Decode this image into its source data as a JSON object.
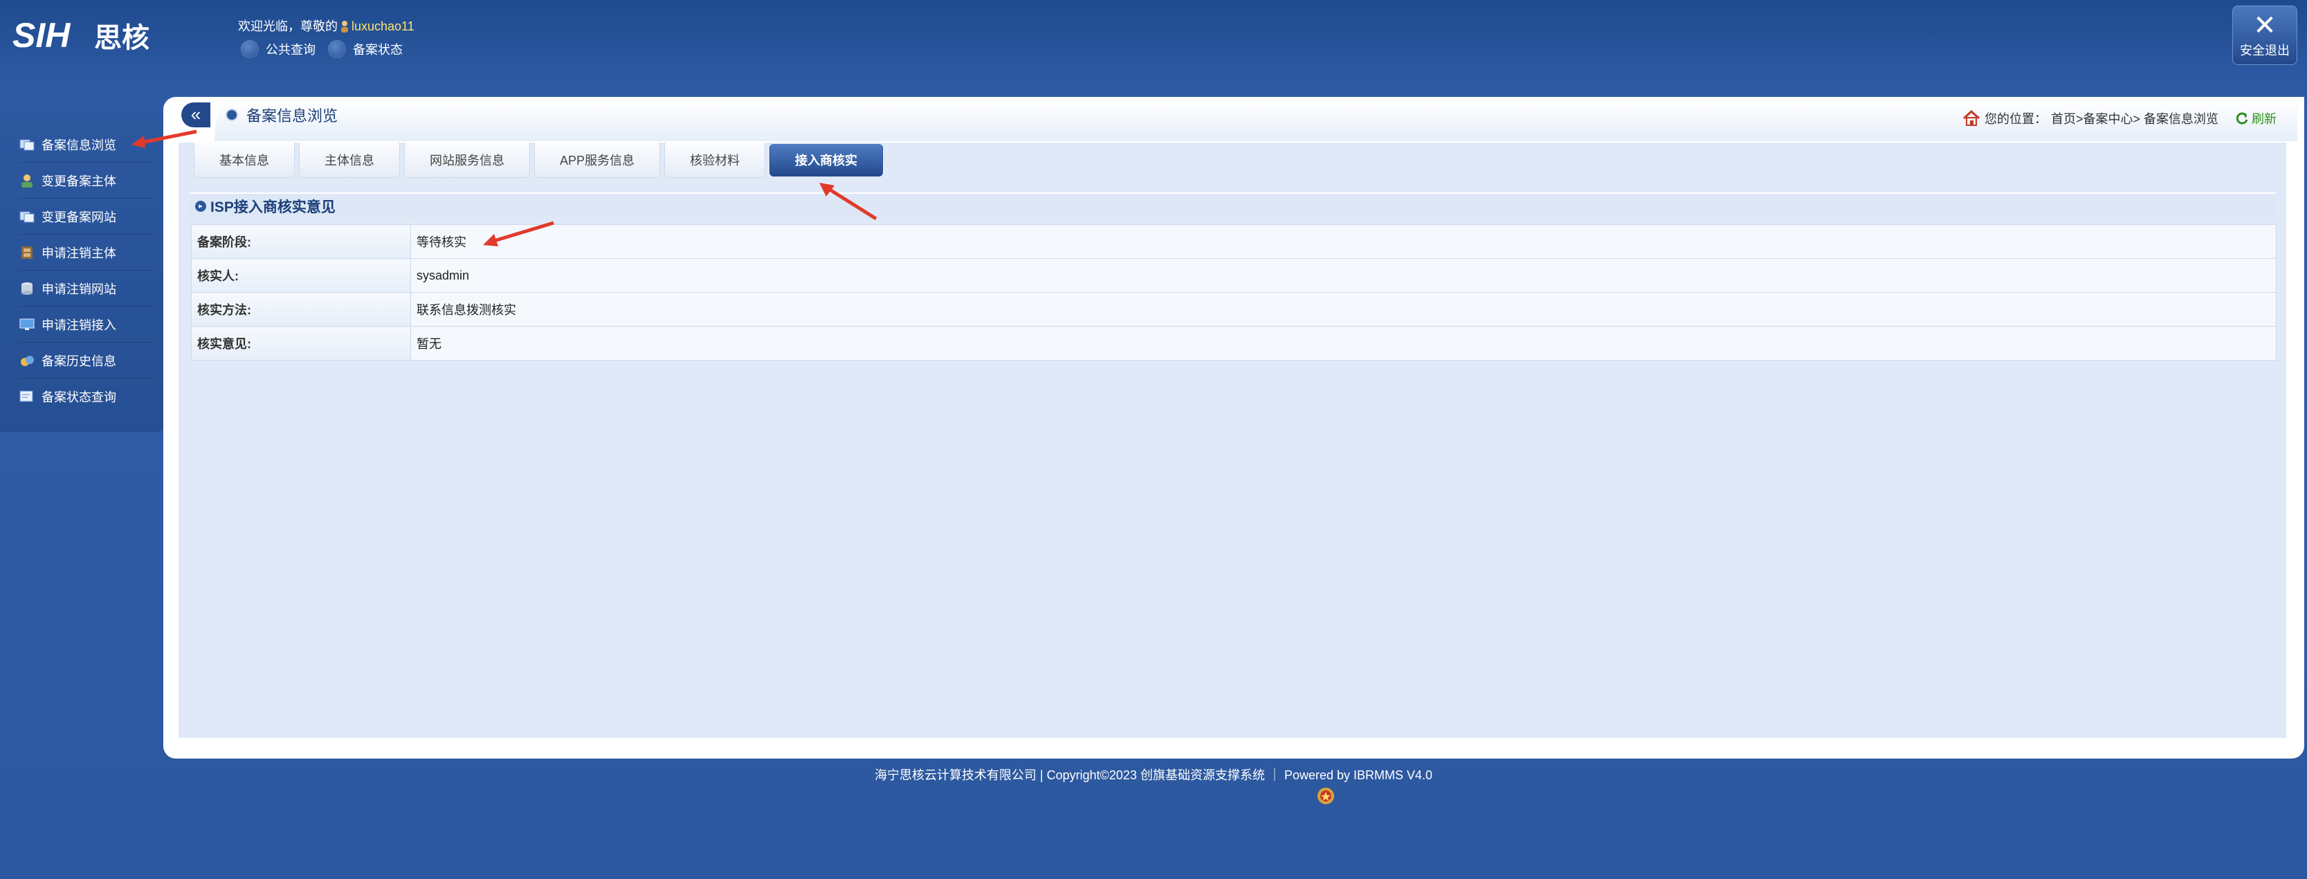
{
  "header": {
    "logo_text": "SIH 思核",
    "welcome_prefix": "欢迎光临，尊敬的",
    "username": "luxuchao11",
    "links": [
      "公共查询",
      "备案状态"
    ],
    "logout_label": "安全退出"
  },
  "sidebar": {
    "items": [
      {
        "label": "备案信息浏览",
        "icon": "document-icon"
      },
      {
        "label": "变更备案主体",
        "icon": "user-icon"
      },
      {
        "label": "变更备案网站",
        "icon": "website-icon"
      },
      {
        "label": "申请注销主体",
        "icon": "cabinet-icon"
      },
      {
        "label": "申请注销网站",
        "icon": "database-icon"
      },
      {
        "label": "申请注销接入",
        "icon": "monitor-icon"
      },
      {
        "label": "备案历史信息",
        "icon": "history-icon"
      },
      {
        "label": "备案状态查询",
        "icon": "search-list-icon"
      }
    ]
  },
  "page": {
    "title": "备案信息浏览",
    "breadcrumb_prefix": "您的位置：",
    "breadcrumb": "首页>备案中心> 备案信息浏览",
    "refresh_label": "刷新"
  },
  "tabs": [
    "基本信息",
    "主体信息",
    "网站服务信息",
    "APP服务信息",
    "核验材料",
    "接入商核实"
  ],
  "active_tab": 5,
  "section": {
    "title": "ISP接入商核实意见",
    "rows": [
      {
        "label": "备案阶段:",
        "value": "等待核实"
      },
      {
        "label": "核实人:",
        "value": "sysadmin"
      },
      {
        "label": "核实方法:",
        "value": "联系信息拨测核实"
      },
      {
        "label": "核实意见:",
        "value": "暂无"
      }
    ]
  },
  "footer": {
    "text": "海宁思核云计算技术有限公司 | Copyright©2023 创旗基础资源支撑系统 ｜ Powered by IBRMMS V4.0"
  },
  "colors": {
    "accent": "#2c589f",
    "highlight_user": "#ffe36a",
    "annotation_arrow": "#e23a2a"
  }
}
